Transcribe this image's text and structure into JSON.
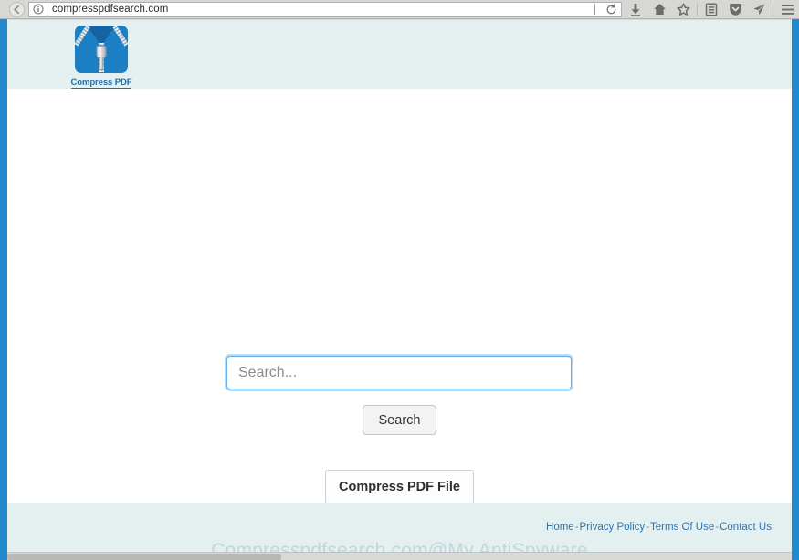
{
  "browser": {
    "url": "compresspdfsearch.com",
    "back_label": "Back",
    "info_icon": "info-icon",
    "reload_icon": "reload-icon",
    "toolbar_icons": [
      {
        "name": "downloads-icon",
        "label": "Downloads"
      },
      {
        "name": "home-icon",
        "label": "Home"
      },
      {
        "name": "bookmark-star-icon",
        "label": "Bookmark this page"
      },
      {
        "name": "library-icon",
        "label": "Show your library"
      },
      {
        "name": "pocket-icon",
        "label": "Save to Pocket"
      },
      {
        "name": "send-icon",
        "label": "Send tab"
      },
      {
        "name": "menu-icon",
        "label": "Open menu"
      }
    ]
  },
  "site": {
    "header": {
      "logo_name": "compress-pdf-logo",
      "logo_text": "Compress PDF"
    },
    "main": {
      "search_placeholder": "Search...",
      "search_value": "",
      "search_button_label": "Search",
      "compress_button_label": "Compress PDF File"
    },
    "footer": {
      "links": [
        {
          "label": "Home"
        },
        {
          "label": "Privacy Policy"
        },
        {
          "label": "Terms Of Use"
        },
        {
          "label": "Contact Us"
        }
      ],
      "separator": "-",
      "watermark": "Compresspdfsearch.com@My AntiSpyware"
    }
  },
  "colors": {
    "brand_blue": "#1c7fc4",
    "band_mint": "#e3f0ef",
    "edge_blue": "#2389ce",
    "link_blue": "#2d74b3",
    "focus_blue": "#66b0e8"
  }
}
